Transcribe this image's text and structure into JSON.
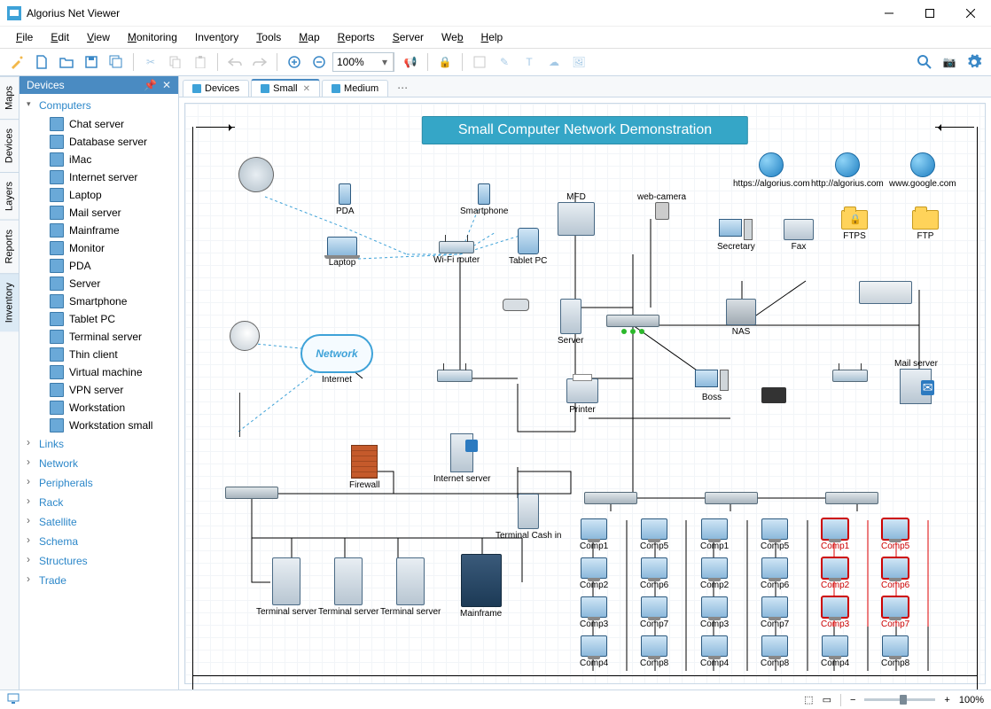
{
  "app": {
    "title": "Algorius Net Viewer"
  },
  "menu": [
    "File",
    "Edit",
    "View",
    "Monitoring",
    "Inventory",
    "Tools",
    "Map",
    "Reports",
    "Server",
    "Web",
    "Help"
  ],
  "menu_underline": [
    0,
    0,
    0,
    0,
    5,
    0,
    0,
    0,
    0,
    2,
    0
  ],
  "toolbar": {
    "zoom": "100%"
  },
  "vert_tabs": [
    "Maps",
    "Devices",
    "Layers",
    "Reports",
    "Inventory"
  ],
  "side": {
    "title": "Devices",
    "expanded_cat": "Computers",
    "computers": [
      "Chat server",
      "Database server",
      "iMac",
      "Internet server",
      "Laptop",
      "Mail server",
      "Mainframe",
      "Monitor",
      "PDA",
      "Server",
      "Smartphone",
      "Tablet PC",
      "Terminal server",
      "Thin client",
      "Virtual machine",
      "VPN server",
      "Workstation",
      "Workstation small"
    ],
    "collapsed_cats": [
      "Links",
      "Network",
      "Peripherals",
      "Rack",
      "Satellite",
      "Schema",
      "Structures",
      "Trade"
    ]
  },
  "doc_tabs": {
    "items": [
      {
        "label": "Devices",
        "closable": false
      },
      {
        "label": "Small",
        "closable": true,
        "active": true
      },
      {
        "label": "Medium",
        "closable": false
      }
    ]
  },
  "diagram": {
    "banner": "Small Computer Network Demonstration",
    "internet_cloud": "Network",
    "internet_label": "Internet",
    "globes": [
      "https://algorius.com",
      "http://algorius.com",
      "www.google.com"
    ],
    "folders": {
      "ftps": "FTPS",
      "ftp": "FTP"
    },
    "nodes": {
      "pda": "PDA",
      "smartphone": "Smartphone",
      "laptop": "Laptop",
      "wifi": "Wi-Fi router",
      "tablet": "Tablet PC",
      "mfd": "MFD",
      "webcam": "web-camera",
      "secretary": "Secretary",
      "fax": "Fax",
      "server": "Server",
      "nas": "NAS",
      "printer": "Printer",
      "boss": "Boss",
      "mail": "Mail server",
      "firewall": "Firewall",
      "iserver": "Internet server",
      "terminal_cash": "Terminal Cash in",
      "mainframe": "Mainframe",
      "tserver1": "Terminal server",
      "tserver2": "Terminal server",
      "tserver3": "Terminal server"
    },
    "grids": [
      {
        "col1": [
          "Comp1",
          "Comp2",
          "Comp3",
          "Comp4"
        ],
        "col2": [
          "Comp5",
          "Comp6",
          "Comp7",
          "Comp8"
        ],
        "red": false
      },
      {
        "col1": [
          "Comp1",
          "Comp2",
          "Comp3",
          "Comp4"
        ],
        "col2": [
          "Comp5",
          "Comp6",
          "Comp7",
          "Comp8"
        ],
        "red": false
      },
      {
        "col1": [
          "Comp1",
          "Comp2",
          "Comp3",
          "Comp4"
        ],
        "col2": [
          "Comp5",
          "Comp6",
          "Comp7",
          "Comp8"
        ],
        "red": true,
        "red_items": [
          "Comp1",
          "Comp5",
          "Comp2",
          "Comp6",
          "Comp3",
          "Comp7"
        ]
      }
    ]
  },
  "status": {
    "zoom_pct": "100%"
  }
}
